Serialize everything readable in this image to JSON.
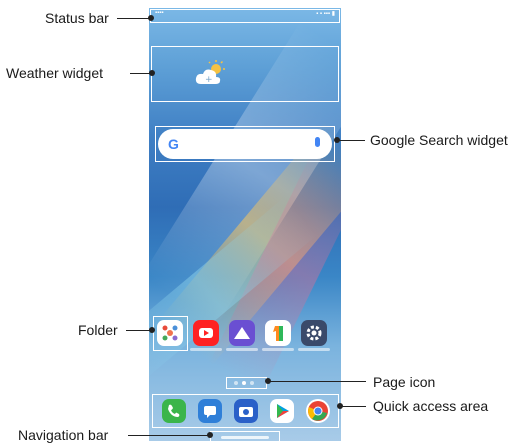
{
  "labels": {
    "status_bar": "Status bar",
    "weather_widget": "Weather widget",
    "google_search_widget": "Google Search widget",
    "folder": "Folder",
    "page_icon": "Page icon",
    "quick_access_area": "Quick access area",
    "navigation_bar": "Navigation bar"
  },
  "colors": {
    "callout_line": "#222222",
    "highlight_box": "#ffffff"
  },
  "home_apps": [
    "folder-icon",
    "youtube-icon",
    "gallery-icon",
    "number-one-icon",
    "settings-icon"
  ],
  "dock_apps": [
    "phone-icon",
    "messages-icon",
    "camera-icon",
    "play-store-icon",
    "chrome-icon"
  ]
}
